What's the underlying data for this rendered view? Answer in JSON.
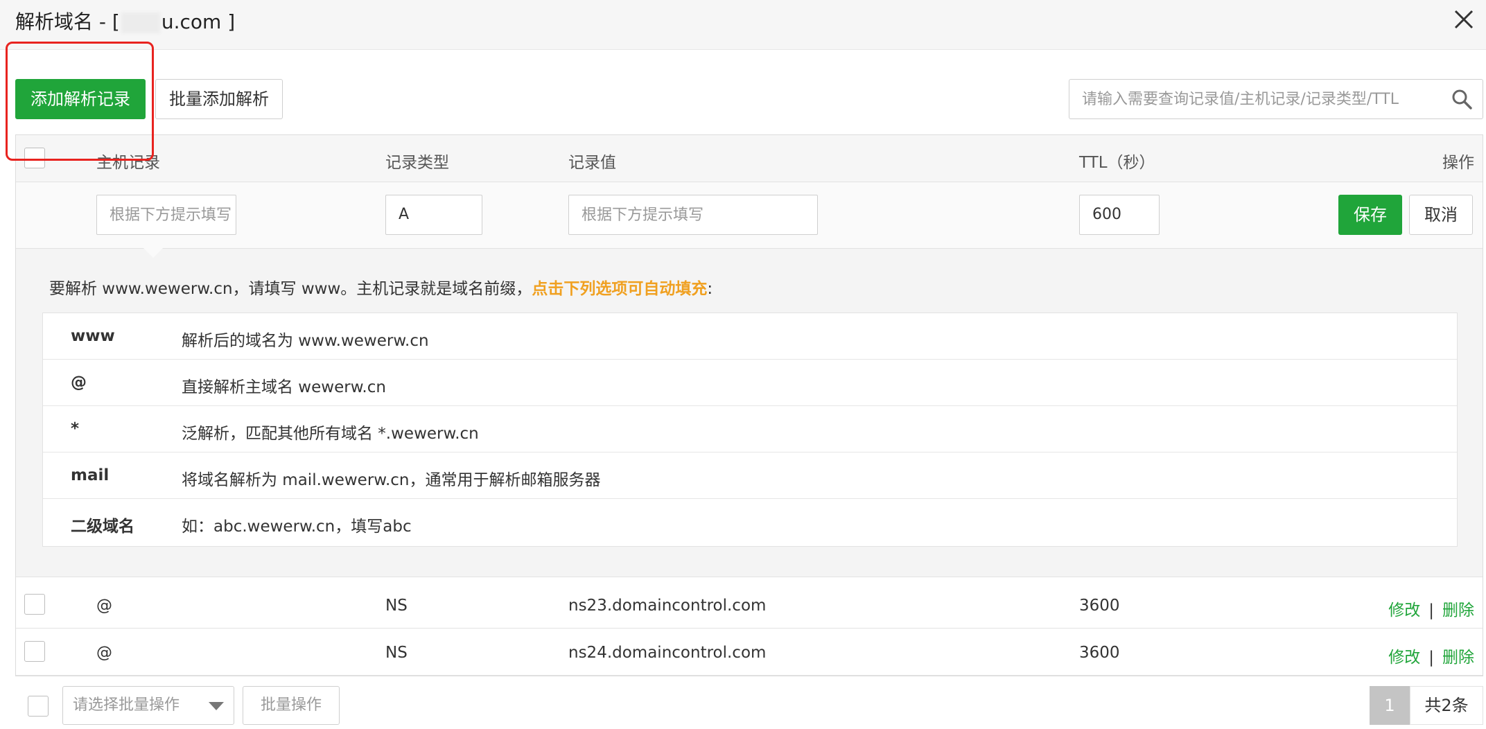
{
  "dialog": {
    "title_prefix": "解析域名 - [",
    "title_suffix": "u.com ]"
  },
  "toolbar": {
    "add_label": "添加解析记录",
    "batch_add_label": "批量添加解析",
    "search_placeholder": "请输入需要查询记录值/主机记录/记录类型/TTL"
  },
  "table": {
    "headers": {
      "host": "主机记录",
      "type": "记录类型",
      "value": "记录值",
      "ttl": "TTL（秒）",
      "ops": "操作"
    },
    "edit": {
      "host_placeholder": "根据下方提示填写",
      "type_value": "A",
      "value_placeholder": "根据下方提示填写",
      "ttl_value": "600",
      "save_label": "保存",
      "cancel_label": "取消"
    },
    "tip": {
      "text": "要解析 www.wewerw.cn，请填写 www。主机记录就是域名前缀，",
      "highlight": "点击下列选项可自动填充",
      "colon": ":",
      "options": [
        {
          "key": "www",
          "desc": "解析后的域名为 www.wewerw.cn"
        },
        {
          "key": "@",
          "desc": "直接解析主域名 wewerw.cn"
        },
        {
          "key": "*",
          "desc": "泛解析，匹配其他所有域名 *.wewerw.cn"
        },
        {
          "key": "mail",
          "desc": "将域名解析为 mail.wewerw.cn，通常用于解析邮箱服务器"
        },
        {
          "key": "二级域名",
          "desc": "如：abc.wewerw.cn，填写abc"
        }
      ]
    },
    "rows": [
      {
        "host": "@",
        "type": "NS",
        "value": "ns23.domaincontrol.com",
        "ttl": "3600",
        "edit": "修改",
        "sep": "|",
        "delete": "删除"
      },
      {
        "host": "@",
        "type": "NS",
        "value": "ns24.domaincontrol.com",
        "ttl": "3600",
        "edit": "修改",
        "sep": "|",
        "delete": "删除"
      }
    ]
  },
  "footer": {
    "batch_select_placeholder": "请选择批量操作",
    "batch_button": "批量操作",
    "current_page": "1",
    "total": "共2条"
  },
  "colors": {
    "primary": "#20a53a",
    "highlight": "#f0a020",
    "annotation": "#e8231f"
  }
}
